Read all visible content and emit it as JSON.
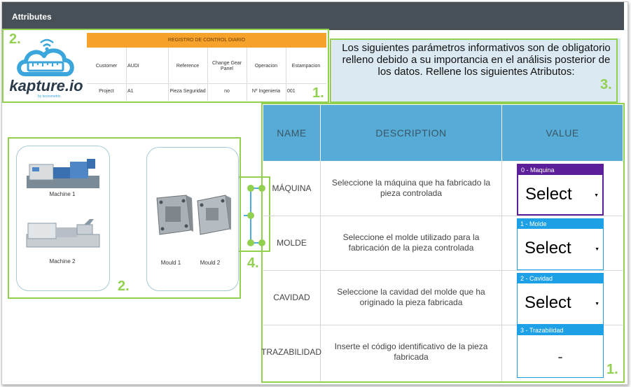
{
  "window": {
    "title": "Attributes"
  },
  "logo": {
    "brand": "kapture.io",
    "tagline": "by tecnometrix"
  },
  "register": {
    "header": "REGISTRO DE CONTROL DIARIO",
    "row1": [
      "Customer",
      "AUDI",
      "Reference",
      "Change Gear Panel",
      "Operacion",
      "Estampacion"
    ],
    "row2": [
      "Project",
      "A1",
      "Pieza Seguridad",
      "no",
      "Nº Ingenieria",
      "001"
    ]
  },
  "info": {
    "text": "Los siguientes parámetros informativos son de obligatorio relleno debido a su importancia en el análisis posterior de los datos. Rellene los siguientes Atributos:"
  },
  "machines": {
    "items": [
      "Machine 1",
      "Machine 2"
    ]
  },
  "moulds": {
    "items": [
      "Mould 1",
      "Mould 2"
    ]
  },
  "params": {
    "headers": [
      "NAME",
      "DESCRIPTION",
      "VALUE"
    ],
    "rows": [
      {
        "name": "MÁQUINA",
        "description": "Seleccione la máquina que ha fabricado la pieza controlada",
        "field_label": "0 - Maquina",
        "value": "Select",
        "color": "#5c1f99"
      },
      {
        "name": "MOLDE",
        "description": "Seleccione el molde utilizado para la fabricación de la pieza controlada",
        "field_label": "1 - Molde",
        "value": "Select",
        "color": "#1ea0e6"
      },
      {
        "name": "CAVIDAD",
        "description": "Seleccione la cavidad del molde que ha originado la pieza fabricada",
        "field_label": "2 - Cavidad",
        "value": "Select",
        "color": "#1ea0e6"
      },
      {
        "name": "TRAZABILIDAD",
        "description": "Inserte el código identificativo de la pieza fabricada",
        "field_label": "3 - Trazabilidad",
        "value": "-",
        "color": "#1ea0e6"
      }
    ]
  },
  "annotations": {
    "n1": "1.",
    "n2": "2.",
    "n3": "3.",
    "n4": "4."
  },
  "colors": {
    "accent_green": "#92d050",
    "header_blue": "#56acd6",
    "topbar": "#474f57",
    "orange": "#f7a22a",
    "purple": "#5c1f99"
  }
}
